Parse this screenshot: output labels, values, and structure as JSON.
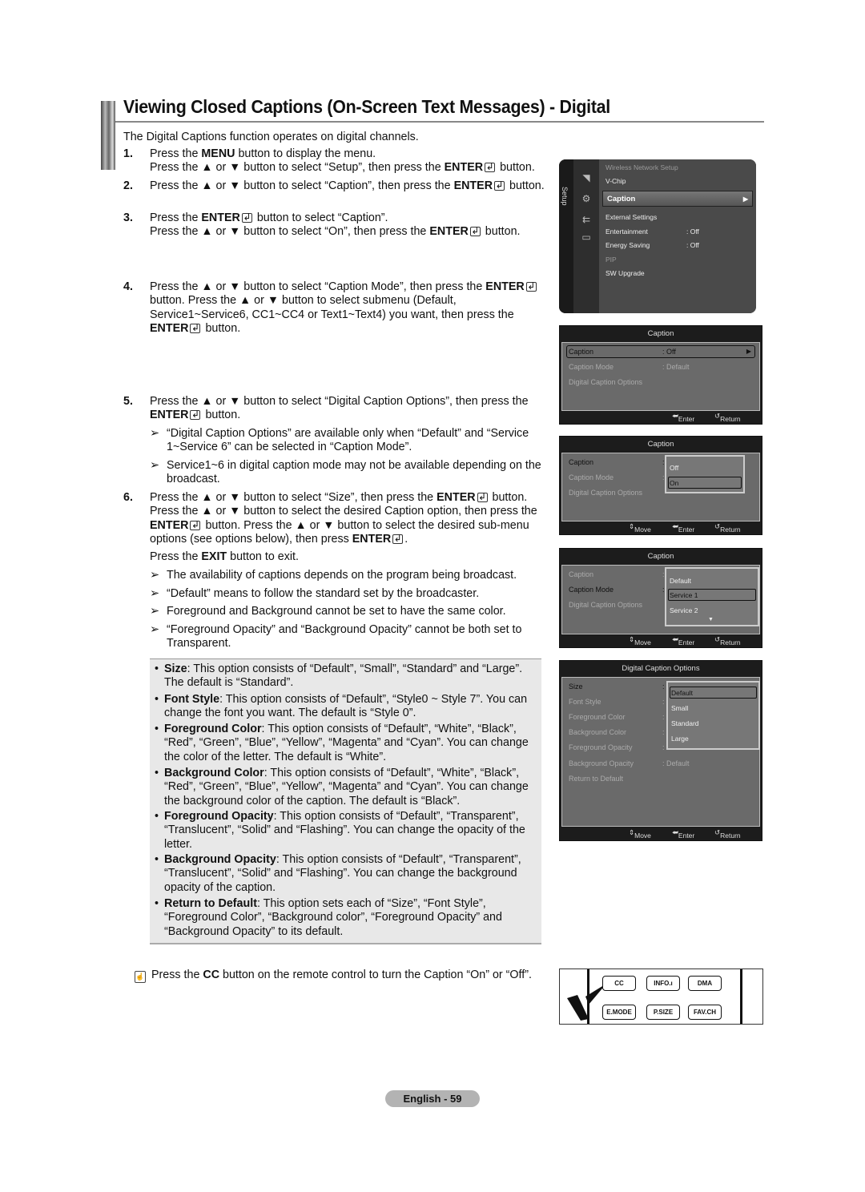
{
  "page": {
    "title": "Viewing Closed Captions (On-Screen Text Messages) - Digital",
    "intro": "The Digital Captions function operates on digital channels.",
    "page_number": "English - 59"
  },
  "steps": [
    {
      "num": "1.",
      "lines": [
        [
          "Press the ",
          {
            "b": "MENU"
          },
          " button to display the menu."
        ],
        [
          "Press the ▲ or ▼ button to select “Setup”, then press the ",
          {
            "b": "ENTER"
          },
          {
            "icon": "enter"
          },
          " button."
        ]
      ]
    },
    {
      "num": "2.",
      "lines": [
        [
          "Press the ▲ or ▼ button to select “Caption”, then press the ",
          {
            "b": "ENTER"
          },
          {
            "icon": "enter"
          },
          " button."
        ]
      ]
    },
    {
      "num": "3.",
      "lines": [
        [
          "Press the ",
          {
            "b": "ENTER"
          },
          {
            "icon": "enter"
          },
          " button to select “Caption”."
        ],
        [
          "Press the ▲ or ▼ button to select “On”, then press the ",
          {
            "b": "ENTER"
          },
          {
            "icon": "enter"
          },
          " button."
        ]
      ]
    },
    {
      "num": "4.",
      "lines": [
        [
          "Press the ▲ or ▼ button to select “Caption Mode”, then press the ",
          {
            "b": "ENTER"
          },
          {
            "icon": "enter"
          },
          " button. Press the ▲ or ▼ button to select submenu (Default, Service1~Service6, CC1~CC4 or Text1~Text4) you want, then press the ",
          {
            "b": "ENTER"
          },
          {
            "icon": "enter"
          },
          " button."
        ]
      ]
    },
    {
      "num": "5.",
      "lines": [
        [
          "Press the ▲ or ▼ button to select “Digital Caption Options”, then press the ",
          {
            "b": "ENTER"
          },
          {
            "icon": "enter"
          },
          " button."
        ]
      ]
    },
    {
      "num": "6.",
      "lines": [
        [
          "Press the ▲ or ▼ button to select “Size”, then press the ",
          {
            "b": "ENTER"
          },
          {
            "icon": "enter"
          },
          " button. Press the ▲ or ▼ button to select the desired Caption option, then press the ",
          {
            "b": "ENTER"
          },
          {
            "icon": "enter"
          },
          " button. Press the ▲ or ▼ button to select the desired sub-menu options (see options below), then press ",
          {
            "b": "ENTER"
          },
          {
            "icon": "enter"
          },
          "."
        ]
      ]
    }
  ],
  "step5_notes": [
    "“Digital Caption Options” are available only when “Default” and “Service 1~Service 6” can be selected in “Caption Mode”.",
    "Service1~6 in digital caption mode may not be available depending on the broadcast."
  ],
  "exit_line": [
    "Press the ",
    {
      "b": "EXIT"
    },
    " button to exit."
  ],
  "exit_notes": [
    "The availability of captions depends on the program being broadcast.",
    "“Default” means to follow the standard set by the broadcaster.",
    "Foreground and Background cannot be set to have the same color.",
    "“Foreground Opacity” and “Background Opacity” cannot be both set to Transparent."
  ],
  "options": [
    {
      "name": "Size",
      "text": ": This option consists of “Default”, “Small”, “Standard” and “Large”. The default is “Standard”."
    },
    {
      "name": "Font Style",
      "text": ": This option consists of “Default”, “Style0 ~ Style 7”. You can change the font you want. The default is “Style 0”."
    },
    {
      "name": "Foreground Color",
      "text": ": This option consists of “Default”, “White”, “Black”, “Red”, “Green”, “Blue”, “Yellow”, “Magenta” and “Cyan”. You can change the color of the letter. The default is “White”."
    },
    {
      "name": "Background Color",
      "text": ": This option consists of “Default”, “White”, “Black”, “Red”, “Green”, “Blue”, “Yellow”, “Magenta” and “Cyan”. You can change the background color of the caption. The default is “Black”."
    },
    {
      "name": "Foreground Opacity",
      "text": ": This option consists of “Default”, “Transparent”, “Translucent”, “Solid” and “Flashing”. You can change the opacity of the letter."
    },
    {
      "name": "Background Opacity",
      "text": ": This option consists of “Default”, “Transparent”, “Translucent”, “Solid” and “Flashing”. You can change the background opacity of the caption."
    },
    {
      "name": "Return to Default",
      "text": ": This option sets each of “Size”, “Font Style”, “Foreground Color”, “Background color”, “Foreground Opacity” and “Background Opacity” to its default."
    }
  ],
  "tip": {
    "pre": "Press the ",
    "bold": "CC",
    "post": " button on the remote control to turn the Caption “On” or “Off”."
  },
  "setup_menu": {
    "side_label": "Setup",
    "items": [
      {
        "label": "Wireless Network Setup",
        "value": "",
        "dim": true
      },
      {
        "label": "V-Chip",
        "value": ""
      },
      {
        "label": "Caption",
        "value": "",
        "selected": true
      },
      {
        "label": "External Settings",
        "value": ""
      },
      {
        "label": "Entertainment",
        "value": ": Off"
      },
      {
        "label": "Energy Saving",
        "value": ": Off"
      },
      {
        "label": "PIP",
        "value": "",
        "dim": true
      },
      {
        "label": "SW Upgrade",
        "value": ""
      }
    ]
  },
  "caption_panel_1": {
    "header": "Caption",
    "rows": [
      {
        "label": "Caption",
        "value": ": Off"
      },
      {
        "label": "Caption Mode",
        "value": ": Default"
      },
      {
        "label": "Digital Caption Options",
        "value": ""
      }
    ],
    "footer": {
      "enter": "Enter",
      "return": "Return"
    }
  },
  "caption_panel_2": {
    "header": "Caption",
    "rows": [
      {
        "label": "Caption",
        "value": ":"
      },
      {
        "label": "Caption Mode",
        "value": ":"
      },
      {
        "label": "Digital Caption Options",
        "value": ""
      }
    ],
    "popup": [
      "Off",
      "On"
    ],
    "popup_selected": "On",
    "footer": {
      "move": "Move",
      "enter": "Enter",
      "return": "Return"
    }
  },
  "caption_panel_3": {
    "header": "Caption",
    "rows": [
      {
        "label": "Caption",
        "value": ":"
      },
      {
        "label": "Caption Mode",
        "value": ":"
      },
      {
        "label": "Digital Caption Options",
        "value": ""
      }
    ],
    "popup": [
      "Default",
      "Service 1",
      "Service 2"
    ],
    "popup_selected": "Service 1",
    "footer": {
      "move": "Move",
      "enter": "Enter",
      "return": "Return"
    }
  },
  "dco_panel": {
    "header": "Digital Caption Options",
    "rows": [
      {
        "label": "Size",
        "value": ":"
      },
      {
        "label": "Font Style",
        "value": ":"
      },
      {
        "label": "Foreground Color",
        "value": ":"
      },
      {
        "label": "Background Color",
        "value": ":"
      },
      {
        "label": "Foreground Opacity",
        "value": ":"
      },
      {
        "label": "Background Opacity",
        "value": ": Default"
      },
      {
        "label": "Return to Default",
        "value": ""
      }
    ],
    "popup": [
      "Default",
      "Small",
      "Standard",
      "Large"
    ],
    "popup_selected": "Default",
    "footer": {
      "move": "Move",
      "enter": "Enter",
      "return": "Return"
    }
  },
  "remote": {
    "row1": [
      "CC",
      "INFO.ı",
      "DMA"
    ],
    "row2": [
      "E.MODE",
      "P.SIZE",
      "FAV.CH"
    ]
  }
}
